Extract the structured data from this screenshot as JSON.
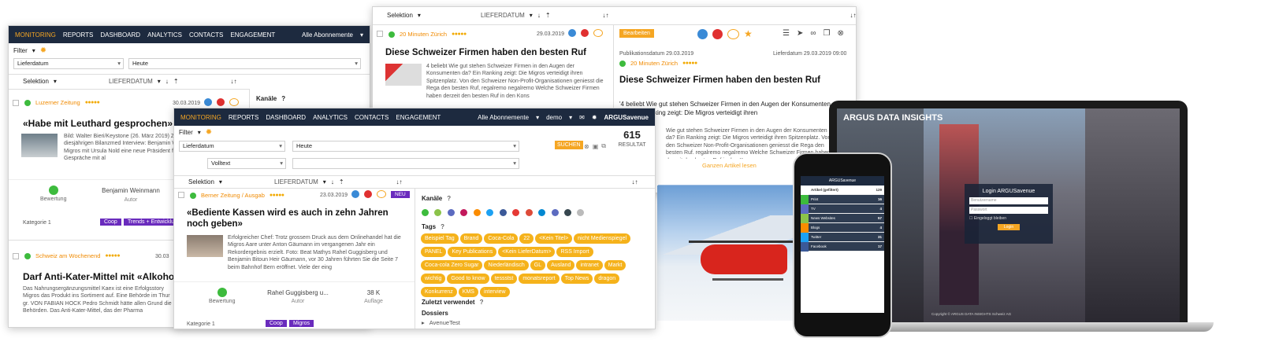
{
  "w1": {
    "nav": [
      "MONITORING",
      "REPORTS",
      "DASHBOARD",
      "ANALYTICS",
      "CONTACTS",
      "ENGAGEMENT"
    ],
    "subs": "Alle Abonnemente",
    "filter": "Filter",
    "lieferdatum": "Lieferdatum",
    "heute": "Heute",
    "selektion": "Selektion",
    "sort": "LIEFERDATUM",
    "a1": {
      "src": "Luzerner Zeitung",
      "date": "30.03.2019",
      "title": "«Habe mit Leuthard gesprochen»",
      "text": "Bild: Walter Bieri/Keystone (26. März 2019) Zumbrunnen an der diesjährigen Bilanzmed Interview: Benjamin Weinmann Vergangene Migros mit Ursula Nold eine neue Präsident führten Sie aber auch Gespräche mit al",
      "bew": "Bewertung",
      "author": "Benjamin Weinmann",
      "autor": "Autor",
      "kat": "Kategorie 1",
      "coop": "Coop",
      "trends": "Trends + Entwicklu"
    },
    "a2": {
      "src": "Schweiz am Wochenend",
      "date": "30.03",
      "title": "Darf Anti-Kater-Mittel mit «Alkohol» w",
      "text": "Das Nahrungsergänzungsmittel Kaex ist eine Erfolgsstory Migros das Produkt ins Sortiment auf. Eine Behörde im Thur gr. VON FABIAN HOCK Pedro Schmidt hätte allen Grund die Behörden. Das Anti-Kater-Mittel, das der Pharma"
    },
    "kanaele": "Kanäle"
  },
  "w2": {
    "selektion": "Selektion",
    "sort": "LIEFERDATUM",
    "left": {
      "src": "20 Minuten Zürich",
      "date": "29.03.2019",
      "title": "Diese Schweizer Firmen haben den besten Ruf",
      "text": "4 beliebt Wie gut stehen Schweizer Firmen in den Augen der Konsumenten da? Ein Ranking zeigt: Die Migros verteidigt ihren Spitzenplatz. Von den Schweizer Non-Profit-Organisationen geniesst die Rega den besten Ruf, regalremo negalremo Welche Schweizer Firmen haben derzeit den besten Ruf in den Kons"
    },
    "right": {
      "edit": "Bearbeiten",
      "pub": "Publikationsdatum 29.03.2019",
      "lief": "Lieferdatum 29.03.2019 09:00",
      "src": "20 Minuten Zürich",
      "title": "Diese Schweizer Firmen haben den besten Ruf",
      "lead": "'4 beliebt Wie gut stehen Schweizer Firmen in den Augen der Konsumenten da? Ein Ranking zeigt: Die Migros verteidigt ihren",
      "body": "Wie gut stehen Schweizer Firmen in den Augen der Konsumenten da? Ein Ranking zeigt: Die Migros verteidigt ihren Spitzenplatz. Von den Schweizer Non-Profit-Organisationen geniesst die Rega den besten Ruf. regalremo negalremo Welche Schweizer Firmen haben derzeit den besten Ruf in den Kons",
      "more": "Ganzen Artikel lesen"
    }
  },
  "w3": {
    "nav": [
      "MONITORING",
      "REPORTS",
      "DASHBOARD",
      "ANALYTICS",
      "CONTACTS",
      "ENGAGEMENT"
    ],
    "subs": "Alle Abonnemente",
    "user": "demo",
    "brand": "ARGUSavenue",
    "filter": "Filter",
    "lieferdatum": "Lieferdatum",
    "heute": "Heute",
    "volltext": "Volltext",
    "suchen": "SUCHEN",
    "count": "615",
    "resultat": "RESULTAT",
    "selektion": "Selektion",
    "sort": "LIEFERDATUM",
    "art": {
      "src": "Berner Zeitung / Ausgab",
      "date": "23.03.2019",
      "neu": "NEU",
      "title": "«Bediente Kassen wird es auch in zehn Jahren noch geben»",
      "text": "Erfolgreicher Chef: Trotz grossem Druck aus dem Onlinehandel hat die Migros Aare unter Anton Gäumann im vergangenen Jahr ein Rekordergebnis erzielt. Foto: Beat Mathys Rahel Guggisberg und Benjamin Bitoun Heir Gäumann, vor 30 Jahren führten Sie die Seite 7 beim Bahnhof Bern eröffnet. Viele der eing",
      "bew": "Bewertung",
      "author": "Rahel Guggisberg u...",
      "autor": "Autor",
      "auflage_v": "38 K",
      "auflage": "Auflage",
      "kat": "Kategorie 1",
      "coop": "Coop",
      "migros": "Migros"
    },
    "kanaele": "Kanäle",
    "tags_label": "Tags",
    "tags": [
      "Beispiel Tag",
      "Brand",
      "Coca-Cola",
      "22",
      "<Kein Titel>",
      "nicht Medienspiegel",
      "PANEL",
      "Key Publications",
      "<Kein LieferDatum>",
      "RSS Import",
      "Coca-cola Zero Sugar",
      "Niederländisch",
      "GL",
      "Ausland",
      "intranet",
      "Markt",
      "wichtig",
      "Good to know",
      "tessstst",
      "monatsreport",
      "Top News",
      "dragon",
      "Konkurrenz",
      "KMS",
      "interview"
    ],
    "zuletzt": "Zuletzt verwendet",
    "dossiers": "Dossiers",
    "dossier1": "AvenueTest"
  },
  "phone": {
    "header": "ARGUSavenue",
    "rows": [
      [
        "Artikel (gefiltert)",
        "129"
      ],
      [
        "Print",
        "16"
      ],
      [
        "TV",
        "4"
      ],
      [
        "News Websites",
        "57"
      ],
      [
        "Blogs",
        "4"
      ],
      [
        "Twitter",
        "31"
      ],
      [
        "Facebook",
        "17"
      ]
    ]
  },
  "laptop": {
    "brand": "ARGUS DATA INSIGHTS",
    "login": "Login ARGUSavenue",
    "user": "Benutzername",
    "pass": "Passwort",
    "remember": "Eingeloggt bleiben",
    "btn": "Login",
    "footer": "Copyright © ARGUS DATA INSIGHTS Schweiz AG"
  }
}
